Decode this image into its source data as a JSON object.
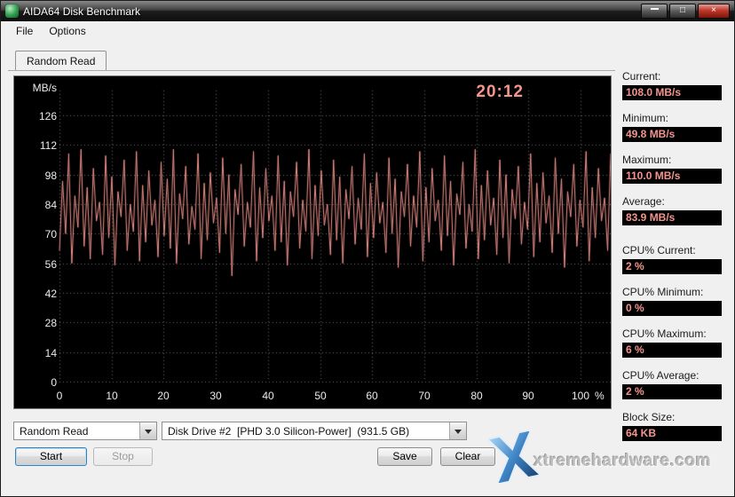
{
  "window": {
    "title": "AIDA64 Disk Benchmark"
  },
  "window_icons": {
    "minimize": "–",
    "maximize": "□",
    "close": "×"
  },
  "menu": {
    "items": [
      "File",
      "Options"
    ]
  },
  "tab": {
    "label": "Random Read"
  },
  "chart_data": {
    "type": "line",
    "title": "Random Read disk benchmark throughput",
    "ylabel": "MB/s",
    "x_unit": "%",
    "elapsed_time": "20:12",
    "y_ticks": [
      126,
      112,
      98,
      84,
      70,
      56,
      42,
      28,
      14,
      0
    ],
    "x_ticks": [
      0,
      10,
      20,
      30,
      40,
      50,
      60,
      70,
      80,
      90,
      100
    ],
    "ylim": [
      0,
      142
    ],
    "xlim": [
      0,
      100
    ],
    "grid": true,
    "line_color": "#f4948d",
    "values": [
      62,
      95,
      70,
      108,
      56,
      88,
      73,
      110,
      64,
      92,
      58,
      101,
      76,
      85,
      60,
      107,
      68,
      97,
      55,
      90,
      78,
      105,
      62,
      84,
      71,
      109,
      57,
      93,
      66,
      100,
      74,
      86,
      59,
      104,
      69,
      96,
      63,
      110,
      56,
      89,
      77,
      102,
      65,
      83,
      72,
      108,
      58,
      94,
      67,
      99,
      75,
      87,
      61,
      106,
      70,
      98,
      50,
      91,
      79,
      103,
      64,
      85,
      73,
      109,
      57,
      92,
      68,
      101,
      76,
      88,
      62,
      107,
      66,
      95,
      55,
      90,
      78,
      104,
      63,
      86,
      71,
      110,
      58,
      93,
      69,
      100,
      74,
      84,
      60,
      105,
      67,
      97,
      56,
      91,
      77,
      102,
      65,
      87,
      72,
      108,
      59,
      94,
      68,
      99,
      75,
      85,
      61,
      106,
      70,
      96,
      54,
      90,
      78,
      103,
      64,
      88,
      73,
      109,
      57,
      92,
      66,
      101,
      76,
      86,
      62,
      107,
      69,
      95,
      55,
      89,
      79,
      104,
      63,
      84,
      71,
      110,
      58,
      93,
      67,
      100,
      74,
      87,
      60,
      105,
      68,
      98,
      56,
      91,
      77,
      102,
      65,
      85,
      72,
      108,
      59,
      94,
      66,
      99,
      75,
      88,
      61,
      106,
      70,
      96,
      54,
      90,
      78,
      103,
      64,
      86,
      73,
      109,
      57,
      92,
      68,
      101,
      76,
      87,
      62,
      108
    ]
  },
  "stats": [
    {
      "label": "Current:",
      "value": "108.0 MB/s"
    },
    {
      "label": "Minimum:",
      "value": "49.8 MB/s"
    },
    {
      "label": "Maximum:",
      "value": "110.0 MB/s"
    },
    {
      "label": "Average:",
      "value": "83.9 MB/s"
    },
    {
      "label": "CPU% Current:",
      "value": "2 %"
    },
    {
      "label": "CPU% Minimum:",
      "value": "0 %"
    },
    {
      "label": "CPU% Maximum:",
      "value": "6 %"
    },
    {
      "label": "CPU% Average:",
      "value": "2 %"
    },
    {
      "label": "Block Size:",
      "value": "64 KB"
    }
  ],
  "controls": {
    "benchmark_type": "Random Read",
    "drive": "Disk Drive #2  [PHD 3.0 Silicon-Power]  (931.5 GB)",
    "buttons": {
      "start": "Start",
      "stop": "Stop",
      "save": "Save",
      "clear": "Clear"
    }
  },
  "watermark": {
    "text": "xtremehardware.com"
  },
  "colors": {
    "accent_salmon": "#f4948d",
    "chart_bg": "#000000",
    "grid": "#666666"
  }
}
